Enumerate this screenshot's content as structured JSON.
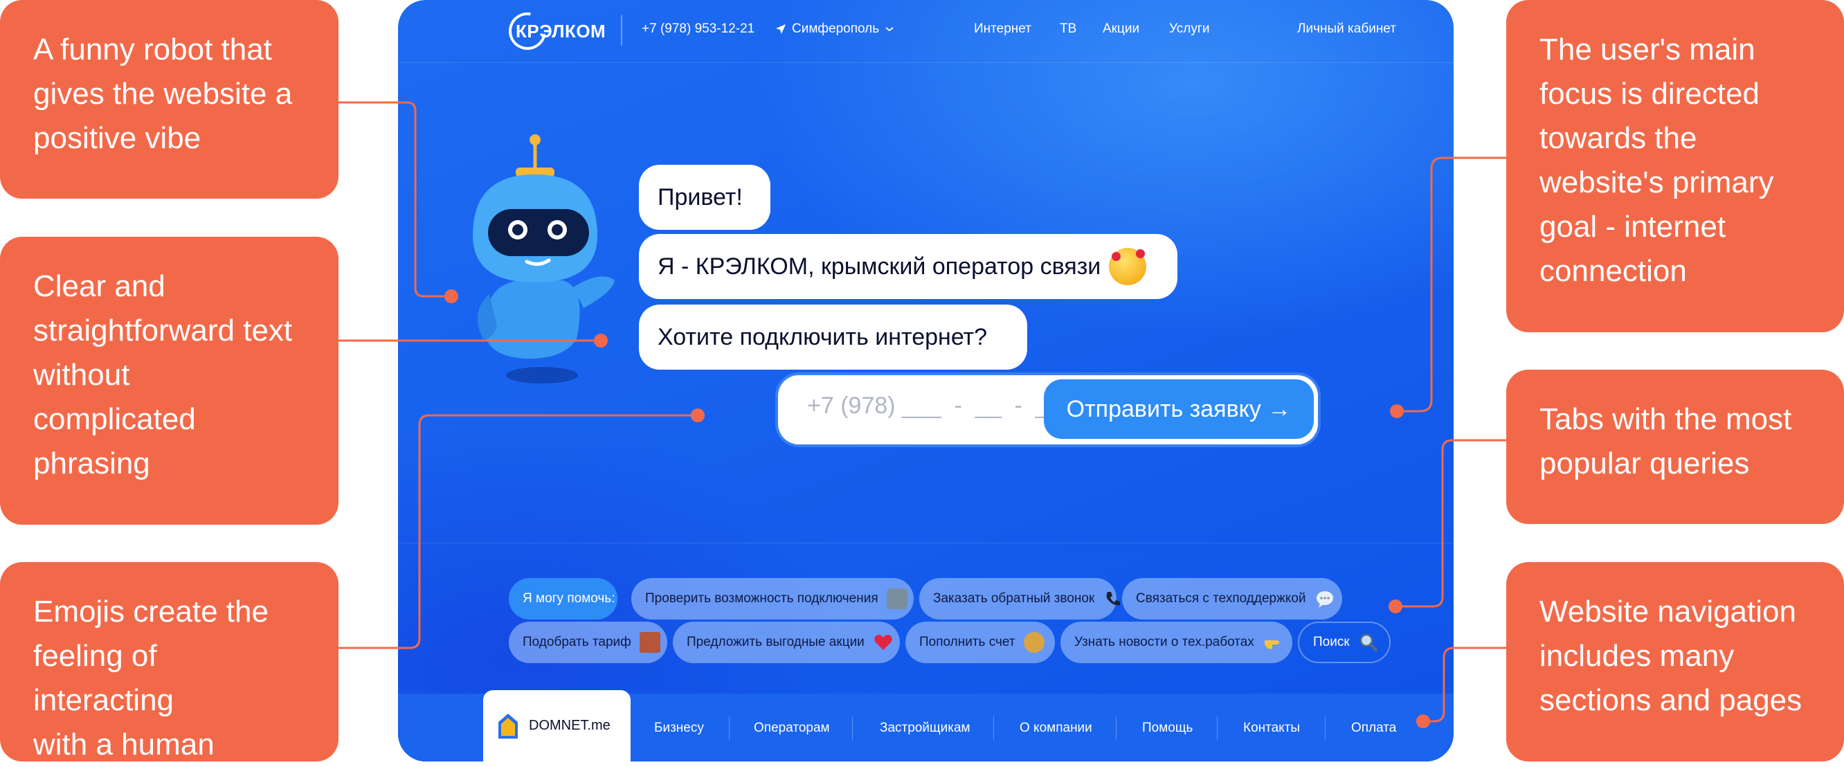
{
  "annotations": {
    "robot": [
      "A funny robot that",
      "gives the website a",
      "positive vibe"
    ],
    "text": [
      "Clear and",
      "straightforward text",
      "without",
      "complicated",
      "phrasing"
    ],
    "emojis": [
      "Emojis create the",
      "feeling of interacting",
      "with a human"
    ],
    "focus": [
      "The user's main",
      "focus is directed",
      "towards the",
      "website's primary",
      "goal - internet",
      "connection"
    ],
    "tabs": [
      "Tabs with the most",
      "popular queries"
    ],
    "navigation": [
      "Website navigation",
      "includes many",
      "sections and pages"
    ]
  },
  "header": {
    "logo": "КРЭЛКОМ",
    "phone": "+7 (978) 953-12-21",
    "city": "Симферополь",
    "nav": [
      "Интернет",
      "ТВ",
      "Акции",
      "Услуги"
    ],
    "account": "Личный кабинет"
  },
  "chat": {
    "greeting": "Привет!",
    "intro": "Я - КРЭЛКОМ, крымский оператор связи",
    "question": "Хотите подключить интернет?"
  },
  "form": {
    "phone_placeholder": "+7 (978) ___  -  __  -  __",
    "submit_label": "Отправить заявку →"
  },
  "help": {
    "lead": "Я могу помочь:",
    "chips": [
      "Проверить возможность подключения",
      "Заказать обратный звонок",
      "Связаться с техподдержкой",
      "Подобрать тариф",
      "Предложить выгодные акции",
      "Пополнить счет",
      "Узнать новости о тех.работах"
    ],
    "search": "Поиск"
  },
  "footer": {
    "partner": "DOMNET.me",
    "nav": [
      "Бизнесу",
      "Операторам",
      "Застройщикам",
      "О компании",
      "Помощь",
      "Контакты",
      "Оплата"
    ]
  },
  "colors": {
    "annotation": "#F2694A",
    "brand_blue": "#1761EE",
    "button": "#2E8CF7"
  }
}
